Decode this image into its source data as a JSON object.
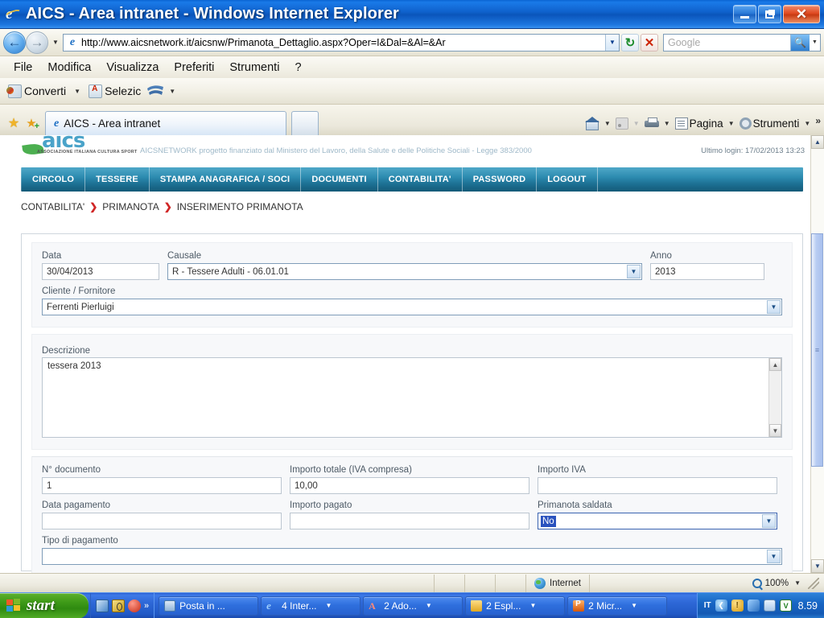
{
  "window": {
    "title": "AICS - Area intranet - Windows Internet Explorer",
    "minimize_label": "Riduci a icona",
    "maximize_label": "Ripristina",
    "close_label": "Chiudi"
  },
  "address_bar": {
    "url": "http://www.aicsnetwork.it/aicsnw/Primanota_Dettaglio.aspx?Oper=I&Dal=&Al=&Ar",
    "back_glyph": "←",
    "forward_glyph": "→",
    "history_caret": "▼",
    "refresh_glyph": "↻",
    "stop_glyph": "✕",
    "search_placeholder": "Google",
    "search_value": "",
    "search_go_glyph": "⌕"
  },
  "menu": {
    "items": [
      "File",
      "Modifica",
      "Visualizza",
      "Preferiti",
      "Strumenti",
      "?"
    ]
  },
  "command_bar": {
    "buttons": [
      {
        "label": "Converti",
        "icon": "convert-icon",
        "has_caret": true
      },
      {
        "label": "Selezic",
        "icon": "select-icon",
        "has_caret": false
      },
      {
        "label": "",
        "icon": "blue-swoosh-icon",
        "has_caret": true
      }
    ],
    "caret": "▼"
  },
  "tab_bar": {
    "favorites_icon": "★",
    "add_favorite_icon": "★",
    "tabs": [
      {
        "label": "AICS - Area intranet",
        "active": true
      },
      {
        "label": "",
        "active": false
      }
    ],
    "right_buttons": [
      {
        "label": "",
        "icon": "home-icon",
        "caret": "▼"
      },
      {
        "label": "",
        "icon": "feed-icon",
        "caret": "▼"
      },
      {
        "label": "",
        "icon": "print-icon",
        "caret": "▼"
      },
      {
        "label": "Pagina",
        "icon": "page-icon",
        "caret": "▼"
      },
      {
        "label": "Strumenti",
        "icon": "gear-icon",
        "caret": "▼"
      }
    ],
    "overflow": "»"
  },
  "site": {
    "logo_text": "aics",
    "logo_subtitle": "ASSOCIAZIONE ITALIANA CULTURA SPORT",
    "funding_note": "AICSNETWORK progetto finanziato dal Ministero del Lavoro, della Salute e delle Politiche Sociali - Legge 383/2000",
    "last_login": "Ultimo login: 17/02/2013 13:23",
    "nav": [
      "CIRCOLO",
      "TESSERE",
      "STAMPA ANAGRAFICA / SOCI",
      "DOCUMENTI",
      "CONTABILITA'",
      "PASSWORD",
      "LOGOUT"
    ],
    "breadcrumb": [
      "CONTABILITA'",
      "PRIMANOTA",
      "INSERIMENTO PRIMANOTA"
    ],
    "breadcrumb_separator": "❯"
  },
  "form": {
    "data": {
      "label": "Data",
      "value": "30/04/2013"
    },
    "causale": {
      "label": "Causale",
      "value": "R - Tessere Adulti - 06.01.01",
      "arrow": "▼"
    },
    "anno": {
      "label": "Anno",
      "value": "2013"
    },
    "cliente_fornitore": {
      "label": "Cliente / Fornitore",
      "value": "Ferrenti Pierluigi",
      "arrow": "▼"
    },
    "descrizione": {
      "label": "Descrizione",
      "value": "tessera 2013",
      "scroll_up": "▲",
      "scroll_down": "▼"
    },
    "n_documento": {
      "label": "N° documento",
      "value": "1"
    },
    "importo_totale": {
      "label": "Importo totale (IVA compresa)",
      "value": "10,00"
    },
    "importo_iva": {
      "label": "Importo IVA",
      "value": ""
    },
    "data_pagamento": {
      "label": "Data pagamento",
      "value": ""
    },
    "importo_pagato": {
      "label": "Importo pagato",
      "value": ""
    },
    "primanota_saldata": {
      "label": "Primanota saldata",
      "value": "No",
      "arrow": "▼",
      "focused": true
    },
    "tipo_pagamento": {
      "label": "Tipo di pagamento",
      "value": "",
      "arrow": "▼"
    }
  },
  "status_bar": {
    "zone": "Internet",
    "zoom": "100%",
    "zoom_caret": "▼"
  },
  "taskbar": {
    "start_label": "start",
    "quick_launch_overflow": "»",
    "tasks": [
      {
        "label": "Posta in ...",
        "icon": "mail-icon",
        "caret": ""
      },
      {
        "label": "4 Inter...",
        "icon": "ie-icon",
        "caret": "▼"
      },
      {
        "label": "2 Ado...",
        "icon": "pdf-icon",
        "caret": "▼"
      },
      {
        "label": "2 Espl...",
        "icon": "folder-icon",
        "caret": "▼"
      },
      {
        "label": "2 Micr...",
        "icon": "powerpoint-icon",
        "caret": "▼"
      }
    ],
    "tray_language": "IT",
    "clock": "8.59"
  },
  "colors": {
    "title_blue": "#0f62cc",
    "nav_teal": "#2d8bb0",
    "breadcrumb_red": "#d02626",
    "select_highlight": "#2a52be",
    "taskbar_blue": "#2d67d6"
  }
}
